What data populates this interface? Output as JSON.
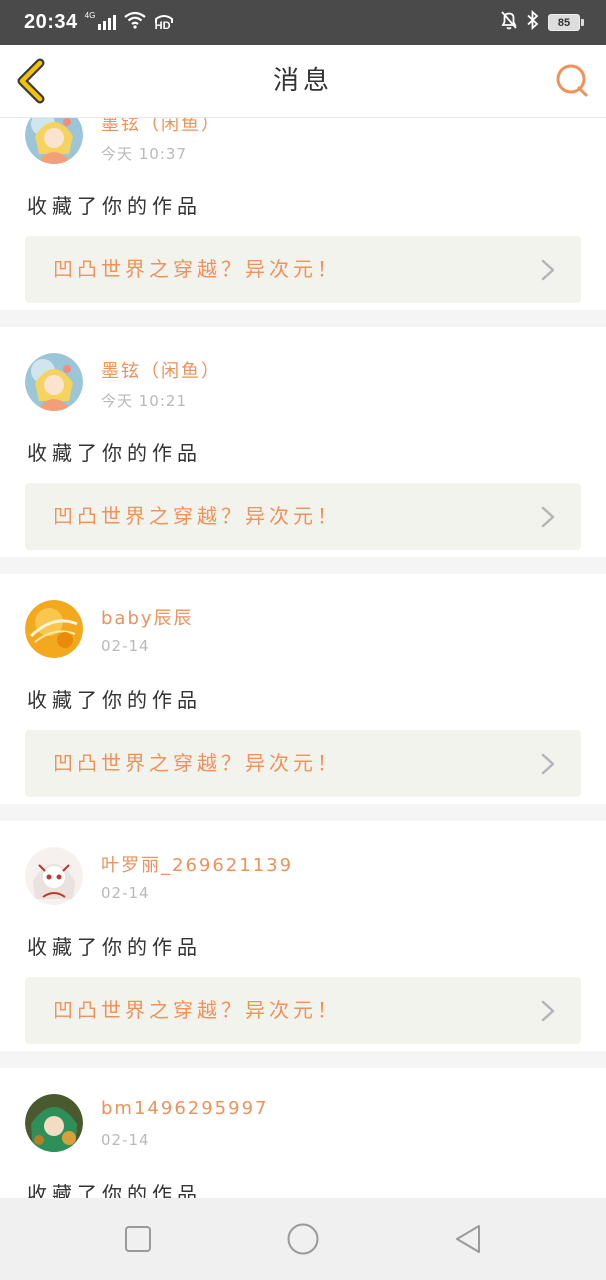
{
  "status_bar": {
    "time": "20:34",
    "network": "4G",
    "hd": "HD",
    "battery": "85"
  },
  "header": {
    "title": "消息"
  },
  "icons": {
    "back": "chevron-left-icon",
    "search": "search-icon",
    "item_arrow": "chevron-right-icon",
    "nav_recent": "square-icon",
    "nav_home": "circle-icon",
    "nav_back": "triangle-back-icon"
  },
  "colors": {
    "accent": "#f0915a",
    "back_icon": "#f5c400",
    "text": "#333333",
    "muted": "#b9b9b9",
    "card_bg": "#ffffff",
    "work_bg": "#f3f3ee"
  },
  "messages": [
    {
      "username": "墨铉（闲鱼）",
      "time": "今天 10:37",
      "action": "收藏了你的作品",
      "work_title": "凹凸世界之穿越？异次元！"
    },
    {
      "username": "墨铉（闲鱼）",
      "time": "今天 10:21",
      "action": "收藏了你的作品",
      "work_title": "凹凸世界之穿越？异次元！"
    },
    {
      "username": "baby辰辰",
      "time": "02-14",
      "action": "收藏了你的作品",
      "work_title": "凹凸世界之穿越？异次元！"
    },
    {
      "username": "叶罗丽_269621139",
      "time": "02-14",
      "action": "收藏了你的作品",
      "work_title": "凹凸世界之穿越？异次元！"
    },
    {
      "username": "bm1496295997",
      "time": "02-14",
      "action": "收藏了你的作品",
      "work_title": ""
    }
  ]
}
